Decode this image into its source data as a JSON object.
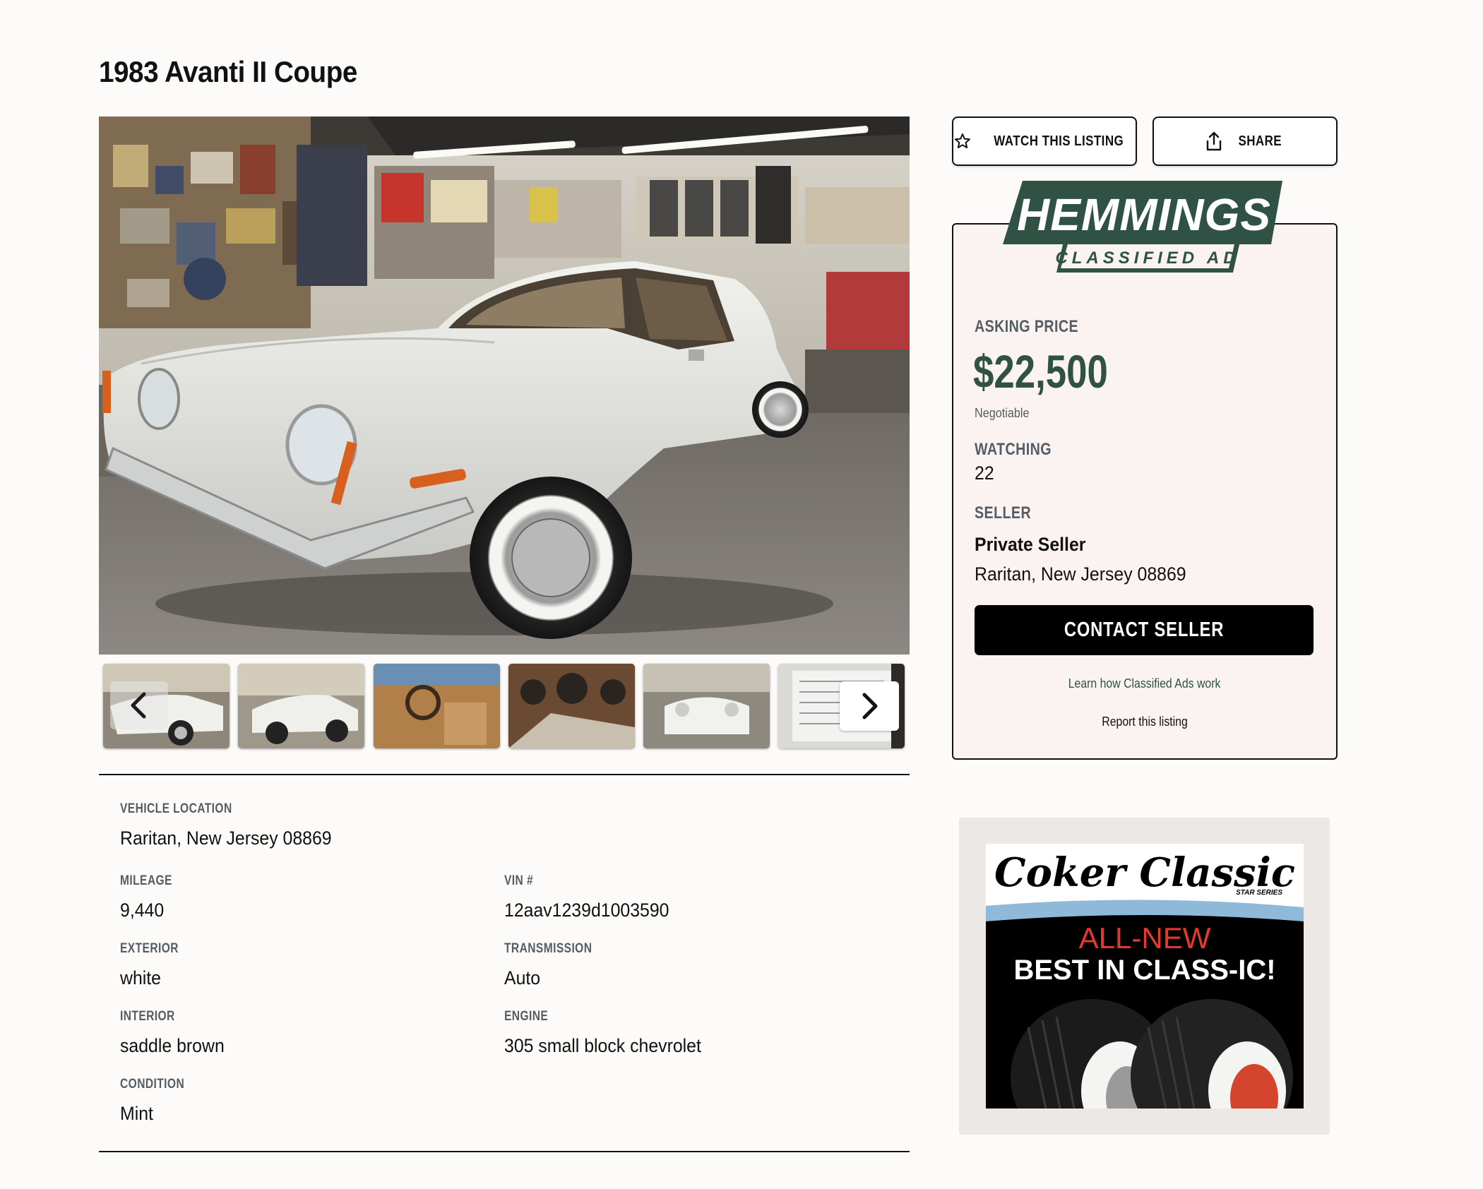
{
  "listing": {
    "title": "1983 Avanti II Coupe"
  },
  "gallery": {
    "thumbnails": [
      "thumb-front-quarter",
      "thumb-side",
      "thumb-interior",
      "thumb-gauges",
      "thumb-front",
      "thumb-document"
    ],
    "prev_icon": "chevron-left-icon",
    "next_icon": "chevron-right-icon"
  },
  "details": {
    "location_label": "VEHICLE LOCATION",
    "location_value": "Raritan, New Jersey 08869",
    "mileage_label": "MILEAGE",
    "mileage_value": "9,440",
    "vin_label": "VIN #",
    "vin_value": "12aav1239d1003590",
    "exterior_label": "EXTERIOR",
    "exterior_value": "white",
    "transmission_label": "TRANSMISSION",
    "transmission_value": "Auto",
    "interior_label": "INTERIOR",
    "interior_value": "saddle brown",
    "engine_label": "ENGINE",
    "engine_value": "305 small block chevrolet",
    "condition_label": "CONDITION",
    "condition_value": "Mint"
  },
  "actions": {
    "watch_label": "WATCH THIS LISTING",
    "watch_icon": "star-outline-icon",
    "share_label": "SHARE",
    "share_icon": "share-upload-icon"
  },
  "classified": {
    "brand": "HEMMINGS",
    "badge": "CLASSIFIED AD",
    "asking_label": "ASKING PRICE",
    "price": "$22,500",
    "price_note": "Negotiable",
    "watching_label": "WATCHING",
    "watching_count": "22",
    "seller_label": "SELLER",
    "seller_name": "Private Seller",
    "seller_location": "Raritan, New Jersey 08869",
    "contact_label": "CONTACT SELLER",
    "learn_link": "Learn how Classified Ads work",
    "report_link": "Report this listing"
  },
  "advert": {
    "brand": "Coker Classic",
    "series": "STAR SERIES",
    "headline_1": "ALL-NEW",
    "headline_2": "BEST IN CLASS-IC!"
  },
  "colors": {
    "brand_green": "#2f5244",
    "page_bg": "#fdfbf9",
    "ad_box_bg": "#fbf3f1",
    "label_gray": "#555d64",
    "advert_red": "#e23b2e"
  }
}
